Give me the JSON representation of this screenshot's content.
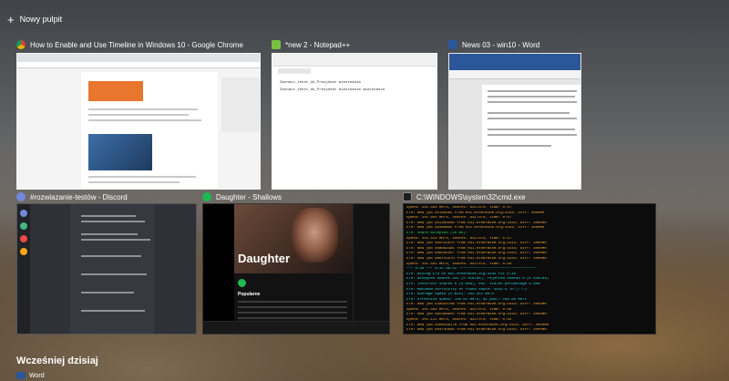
{
  "new_desktop": {
    "label": "Nowy pulpit"
  },
  "windows": {
    "chrome": {
      "title": "How to Enable and Use Timeline in Windows 10 - Google Chrome",
      "icon": "chrome-icon"
    },
    "notepad": {
      "title": "*new 2 - Notepad++",
      "icon": "notepad-icon",
      "lines": [
        "Zaznacz_tekst_do_Prezydent mieszkania",
        "Zaznacz_tekst_do_Prezydent mieszkania mieszkanie"
      ]
    },
    "word": {
      "title": "News 03 - win10 - Word",
      "icon": "word-icon"
    },
    "discord": {
      "title": "#rozwiazanie-testów - Discord",
      "icon": "discord-icon"
    },
    "spotify": {
      "title": "Daughter - Shallows",
      "icon": "spotify-icon",
      "artist": "Daughter",
      "section": "Popularne"
    },
    "cmd": {
      "title": "C:\\WINDOWS\\system32\\cmd.exe",
      "icon": "cmd-icon",
      "lines": [
        {
          "t": "speed: 101.464 MH/s, shares: 841/0/0, time: 0:47",
          "c": ""
        },
        {
          "t": "ETH: New job #c166d82 from eu1.ethermine.org:4444; diff: 4000MH",
          "c": ""
        },
        {
          "t": "speed: 101.464 MH/s, shares: 841/0/0, time: 0:47",
          "c": ""
        },
        {
          "t": "ETH: New job #9130dce8 from eu1.ethermine.org:4444; diff: 4000MH",
          "c": ""
        },
        {
          "t": "ETH: New job #9460a04 from eu1.ethermine.org:4444; diff: 4000MH",
          "c": ""
        },
        {
          "t": "ETH: Share accepted (40 ms)!",
          "c": "ok"
        },
        {
          "t": "speed: 101.414 MH/s, shares: 842/0/0, time: 0:47",
          "c": ""
        },
        {
          "t": "ETH: New job #06f42870 from eu1.ethermine.org:4444; diff: 4000MH",
          "c": ""
        },
        {
          "t": "ETH: New job #0a0a3485 from eu1.ethermine.org:4444; diff: 4000MH",
          "c": ""
        },
        {
          "t": "ETH: New job #665d5c07 from eu1.ethermine.org:4444; diff: 4000MH",
          "c": ""
        },
        {
          "t": "ETH: New job #06f42870 from eu1.ethermine.org:4444; diff: 4000MH",
          "c": ""
        },
        {
          "t": "speed: 101.464 MH/s, shares: 842/0/0, time: 0:48",
          "c": ""
        },
        {
          "t": "*** 0:48 *** 4/15 08:52 ***********************************",
          "c": "cy"
        },
        {
          "t": "ETH: Mining ETH on eu1.ethermine.org:4444 for 0:48",
          "c": "cy"
        },
        {
          "t": "ETH: Accepted shares 941 (0 stales), rejected shares 0 (0 stales)",
          "c": "cy"
        },
        {
          "t": "ETH: Incorrect shares 0 (0.00%), est. stales percentage 0.00%",
          "c": "cy"
        },
        {
          "t": "ETH: Maximum difficulty of found share: 4024.9 TH (!!!)",
          "c": "cy"
        },
        {
          "t": "ETH: Average speed (5 min): 101.451 MH/s",
          "c": "cy"
        },
        {
          "t": "ETH: Effective speed: 100.81 MH/s; at pool: 100.89 MH/s",
          "c": "cy"
        },
        {
          "t": "ETH: New job #3a45d7da from eu1.ethermine.org:4444; diff: 4000MH",
          "c": ""
        },
        {
          "t": "speed: 101.464 MH/s, shares: 842/0/0, time: 0:48",
          "c": ""
        },
        {
          "t": "ETH: New job #a5ddab5c from eu1.ethermine.org:4444; diff: 4000MH",
          "c": ""
        },
        {
          "t": "speed: 101.111 MH/s, shares: 842/0/0, time: 0:48",
          "c": ""
        },
        {
          "t": "ETH: New job #5ea5d817a from eu1.ethermine.org:4444; diff: 4000MH",
          "c": ""
        },
        {
          "t": "ETH: New job #d4f30b06 from eu1.ethermine.org:4444; diff: 4000MH",
          "c": ""
        },
        {
          "t": "ETH: New job #2f38d7b9 from eu1.ethermine.org:4444; diff: 4000MH",
          "c": ""
        }
      ]
    }
  },
  "earlier": {
    "section_title": "Wcześniej dzisiaj",
    "item_label": "Word"
  },
  "colors": {
    "chrome": "#db4437",
    "notepad": "#7ac143",
    "word": "#2b579a",
    "discord": "#7289da",
    "spotify": "#1db954",
    "cmd": "#1e1e1e"
  }
}
